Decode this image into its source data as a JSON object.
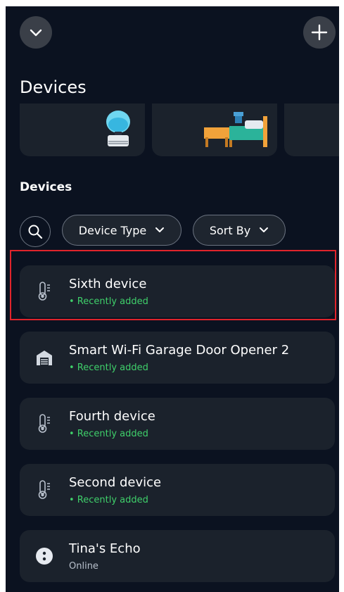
{
  "page": {
    "title": "Devices",
    "section_label": "Devices"
  },
  "header": {
    "collapse_icon": "chevron-down-icon",
    "add_icon": "plus-icon"
  },
  "filters": {
    "search_icon": "search-icon",
    "device_type_label": "Device Type",
    "sort_by_label": "Sort By"
  },
  "devices": [
    {
      "name": "Sixth device",
      "status": "• Recently added",
      "icon": "thermometer-icon",
      "status_color": "#3fcf6a",
      "highlighted": true
    },
    {
      "name": "Smart Wi-Fi Garage Door Opener 2",
      "status": "• Recently added",
      "icon": "garage-icon",
      "status_color": "#3fcf6a",
      "highlighted": false
    },
    {
      "name": "Fourth device",
      "status": "• Recently added",
      "icon": "thermometer-icon",
      "status_color": "#3fcf6a",
      "highlighted": false
    },
    {
      "name": "Second device",
      "status": "• Recently added",
      "icon": "thermometer-icon",
      "status_color": "#3fcf6a",
      "highlighted": false
    },
    {
      "name": "Tina's Echo",
      "status": "Online",
      "icon": "echo-speaker-icon",
      "status_color": "#b8c0cc",
      "highlighted": false
    }
  ],
  "colors": {
    "background": "#0b1220",
    "card": "#1b222c",
    "accent_green": "#3fcf6a",
    "highlight": "#e0242b"
  }
}
